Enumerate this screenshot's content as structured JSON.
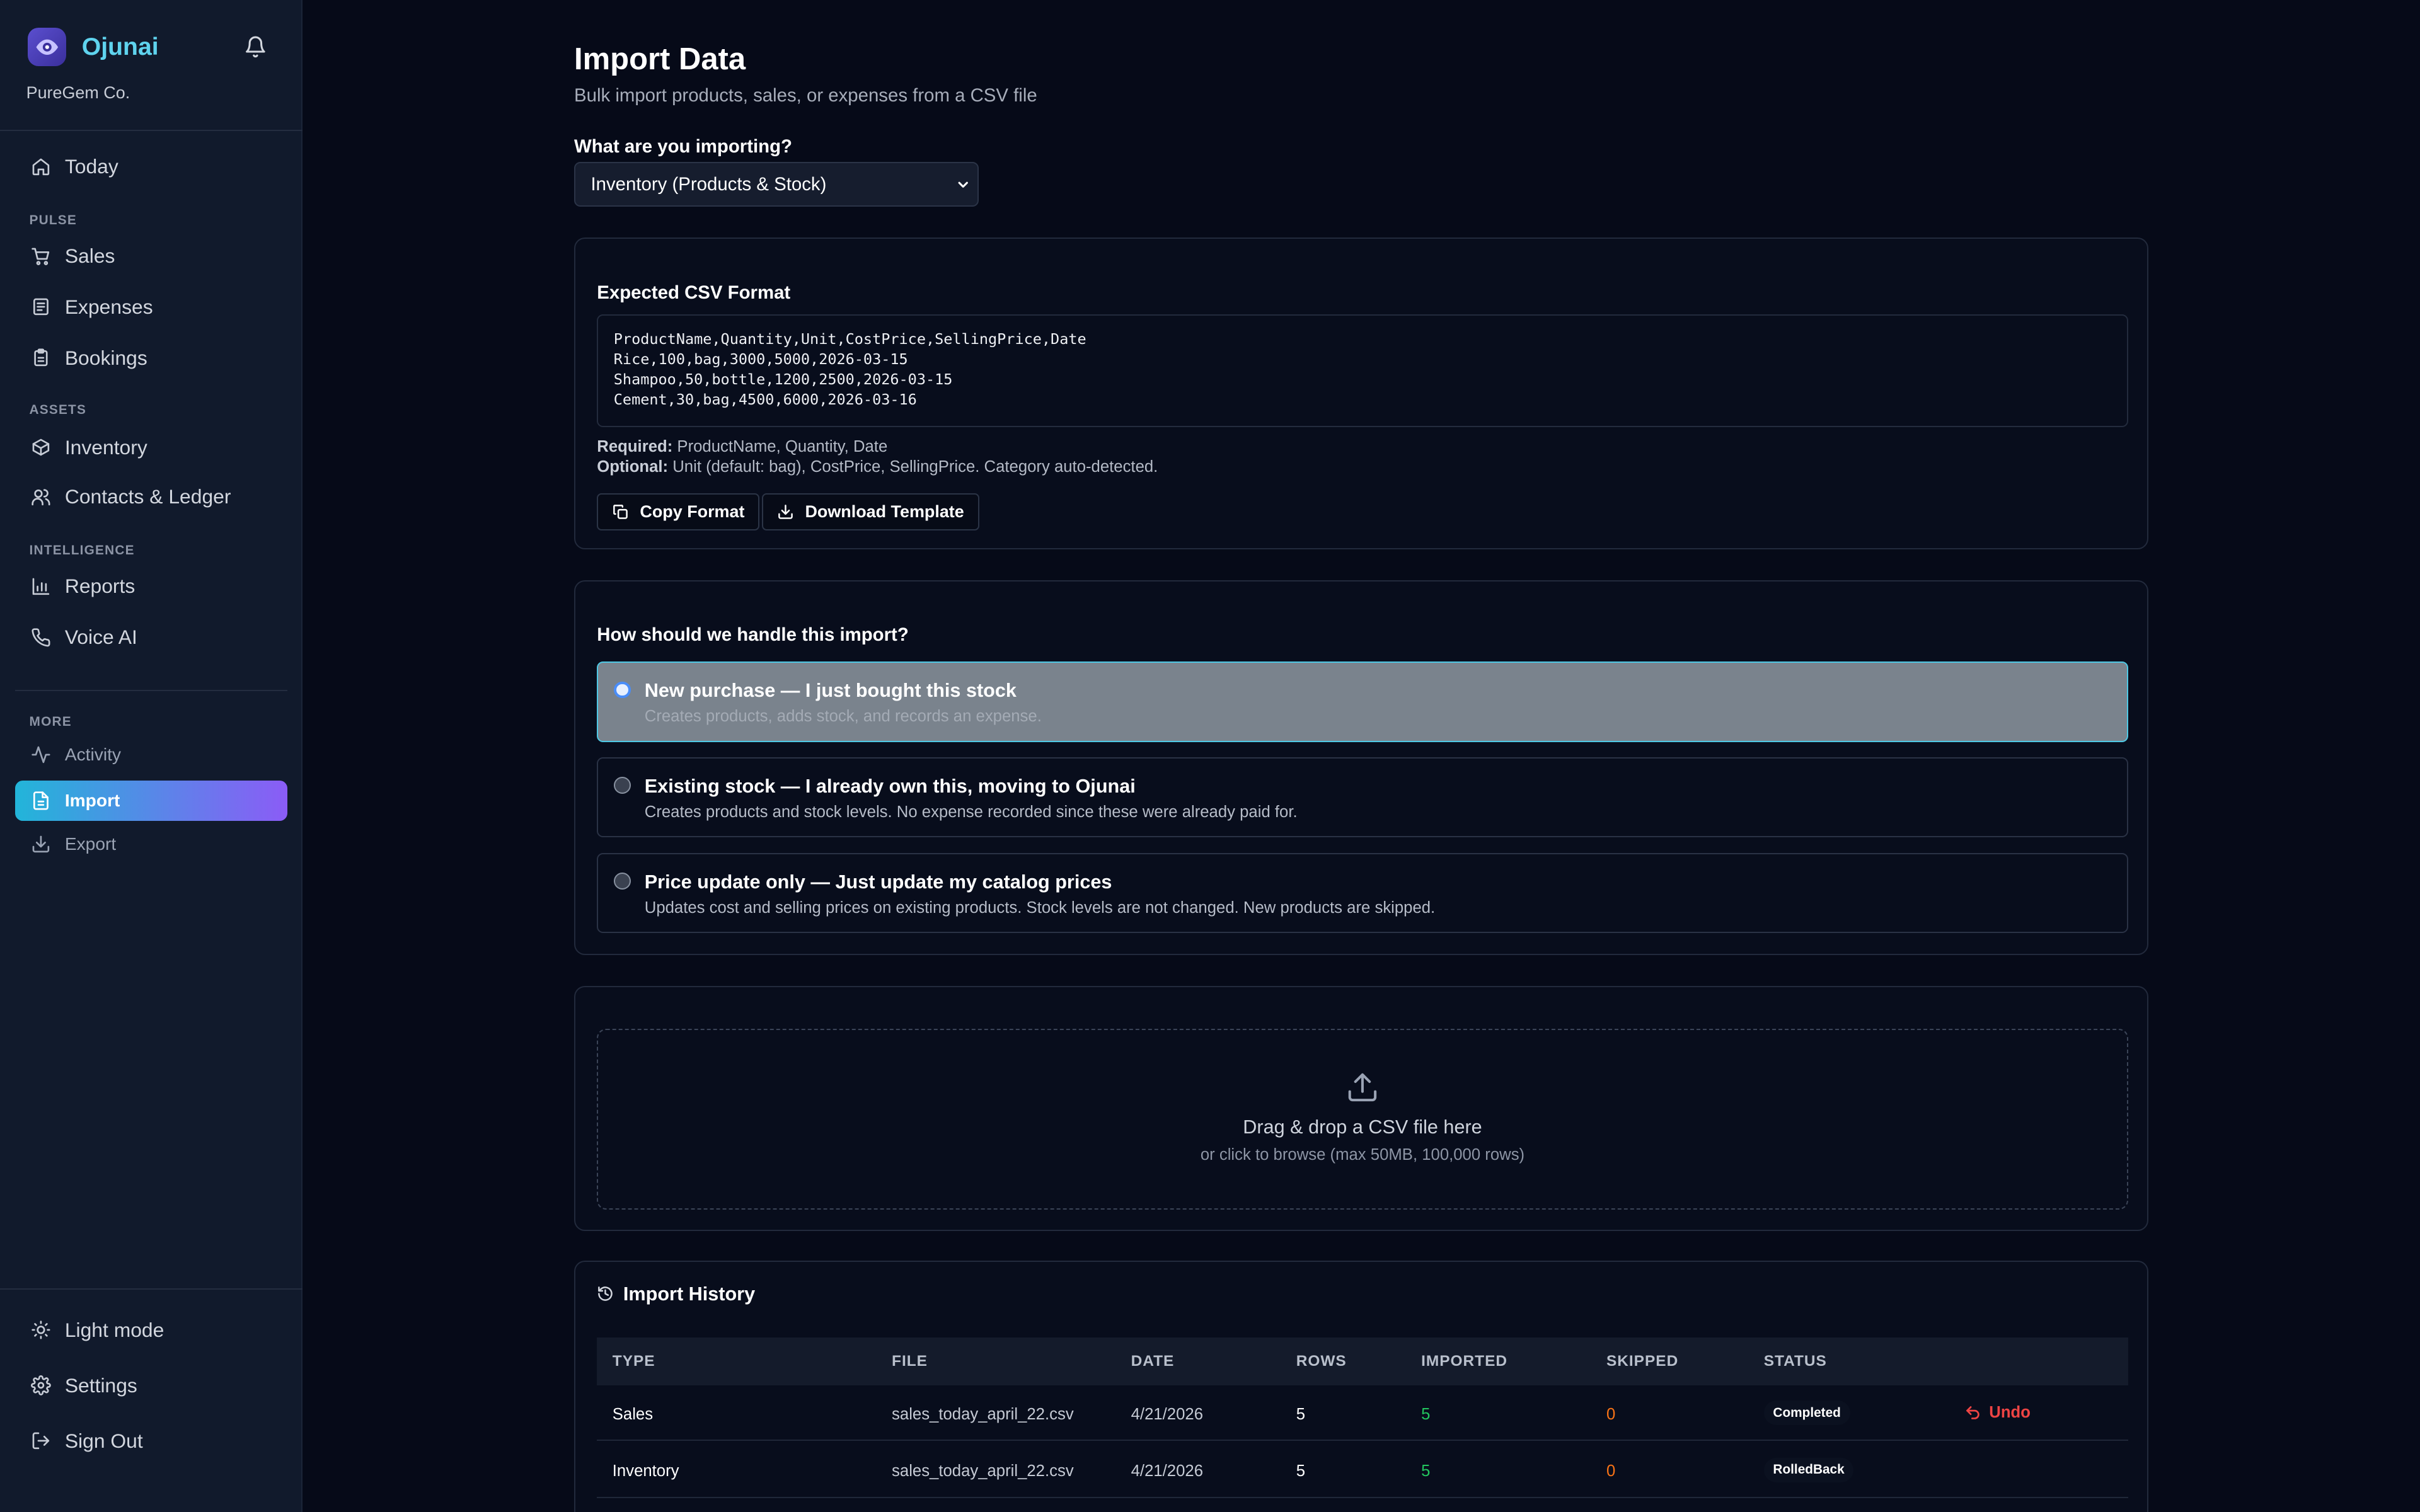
{
  "sidebar": {
    "brand": "Ojunai",
    "company": "PureGem Co.",
    "today": "Today",
    "sections": {
      "pulse": "PULSE",
      "assets": "ASSETS",
      "intelligence": "INTELLIGENCE",
      "more": "MORE"
    },
    "items": {
      "sales": "Sales",
      "expenses": "Expenses",
      "bookings": "Bookings",
      "inventory": "Inventory",
      "contacts": "Contacts & Ledger",
      "reports": "Reports",
      "voice": "Voice AI",
      "activity": "Activity",
      "import": "Import",
      "export": "Export"
    },
    "footer": {
      "light_mode": "Light mode",
      "settings": "Settings",
      "sign_out": "Sign Out"
    },
    "accent_gradient": [
      "#22b5d9",
      "#8b5cf6"
    ]
  },
  "header": {
    "title": "Import Data",
    "subtitle": "Bulk import products, sales, or expenses from a CSV file"
  },
  "import_type": {
    "label": "What are you importing?",
    "selected": "Inventory (Products & Stock)"
  },
  "csv_format": {
    "title": "Expected CSV Format",
    "lines": [
      "ProductName,Quantity,Unit,CostPrice,SellingPrice,Date",
      "Rice,100,bag,3000,5000,2026-03-15",
      "Shampoo,50,bottle,1200,2500,2026-03-15",
      "Cement,30,bag,4500,6000,2026-03-16"
    ],
    "required_label": "Required:",
    "required_text": "ProductName, Quantity, Date",
    "optional_label": "Optional:",
    "optional_text": "Unit (default: bag), CostPrice, SellingPrice. Category auto-detected.",
    "copy_button": "Copy Format",
    "download_button": "Download Template"
  },
  "handling": {
    "title": "How should we handle this import?",
    "options": [
      {
        "title": "New purchase — I just bought this stock",
        "desc": "Creates products, adds stock, and records an expense.",
        "selected": true
      },
      {
        "title": "Existing stock — I already own this, moving to Ojunai",
        "desc": "Creates products and stock levels. No expense recorded since these were already paid for.",
        "selected": false
      },
      {
        "title": "Price update only — Just update my catalog prices",
        "desc": "Updates cost and selling prices on existing products. Stock levels are not changed. New products are skipped.",
        "selected": false
      }
    ]
  },
  "upload": {
    "title": "Drag & drop a CSV file here",
    "subtitle": "or click to browse (max 50MB, 100,000 rows)"
  },
  "history": {
    "title": "Import History",
    "columns": [
      "TYPE",
      "FILE",
      "DATE",
      "ROWS",
      "IMPORTED",
      "SKIPPED",
      "STATUS"
    ],
    "rows": [
      {
        "type": "Sales",
        "file": "sales_today_april_22.csv",
        "date": "4/21/2026",
        "rows": "5",
        "imported": "5",
        "skipped": "0",
        "status": "Completed",
        "action": "Undo"
      },
      {
        "type": "Inventory",
        "file": "sales_today_april_22.csv",
        "date": "4/21/2026",
        "rows": "5",
        "imported": "5",
        "skipped": "0",
        "status": "RolledBack",
        "action": ""
      }
    ]
  },
  "colors": {
    "imported": "#22c55e",
    "skipped": "#f97316",
    "undo": "#ef4444",
    "brand": "#5fd3ee"
  }
}
